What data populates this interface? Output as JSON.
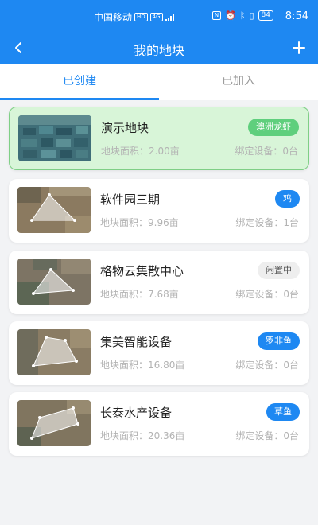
{
  "status_bar": {
    "carrier": "中国移动",
    "hd": "HD",
    "network": "4G",
    "nfc": "N",
    "battery": "84",
    "time": "8:54"
  },
  "header": {
    "title": "我的地块"
  },
  "tabs": [
    {
      "label": "已创建",
      "active": true
    },
    {
      "label": "已加入",
      "active": false
    }
  ],
  "plots": [
    {
      "name": "演示地块",
      "area": "地块面积：2.00亩",
      "devices": "绑定设备：0台",
      "tag": "澳洲龙虾",
      "tag_style": "green",
      "selected": true
    },
    {
      "name": "软件园三期",
      "area": "地块面积：9.96亩",
      "devices": "绑定设备：1台",
      "tag": "鸡",
      "tag_style": "blue",
      "selected": false
    },
    {
      "name": "格物云集散中心",
      "area": "地块面积：7.68亩",
      "devices": "绑定设备：0台",
      "tag": "闲置中",
      "tag_style": "gray",
      "selected": false
    },
    {
      "name": "集美智能设备",
      "area": "地块面积：16.80亩",
      "devices": "绑定设备：0台",
      "tag": "罗非鱼",
      "tag_style": "blue",
      "selected": false
    },
    {
      "name": "长泰水产设备",
      "area": "地块面积：20.36亩",
      "devices": "绑定设备：0台",
      "tag": "草鱼",
      "tag_style": "blue",
      "selected": false
    }
  ],
  "colors": {
    "primary": "#1e88f2",
    "selected_bg": "#d8f5d8",
    "tag_green": "#5fcf7d",
    "tag_gray": "#eeeeee"
  }
}
